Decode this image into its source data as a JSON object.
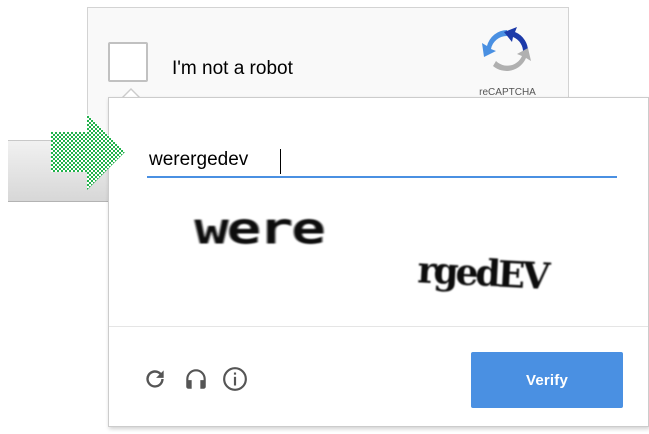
{
  "anchor": {
    "label": "I'm not a robot",
    "brand": "reCAPTCHA",
    "checked": false
  },
  "challenge": {
    "answer_value": "werergedev",
    "image_words": [
      "were",
      "rgedEV"
    ],
    "verify_label": "Verify",
    "controls": [
      "reload-icon",
      "headphones-icon",
      "info-icon"
    ]
  },
  "colors": {
    "accent": "#4a90e2",
    "arrow": "#22b24c",
    "logo_blue": "#1c3aa9",
    "logo_light_blue": "#4a90e2",
    "logo_gray": "#b0b0b0"
  }
}
